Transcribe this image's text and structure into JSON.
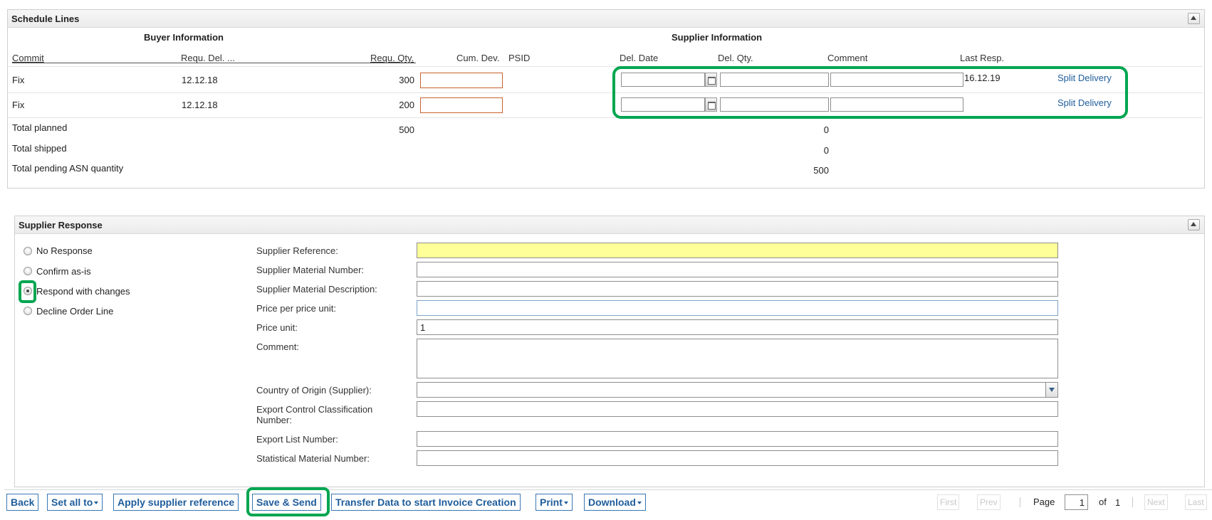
{
  "schedule_lines": {
    "title": "Schedule Lines",
    "buyer_header": "Buyer Information",
    "supplier_header": "Supplier Information",
    "columns": {
      "commit": "Commit",
      "requ_del": "Requ. Del. ...",
      "requ_qty": "Requ. Qty.",
      "cum_dev": "Cum. Dev.",
      "psid": "PSID",
      "del_date": "Del. Date",
      "del_qty": "Del. Qty.",
      "comment": "Comment",
      "last_resp": "Last Resp."
    },
    "rows": [
      {
        "commit": "Fix",
        "requ_del": "12.12.18",
        "requ_qty": "300",
        "last_resp": "16.12.19",
        "split_label": "Split Delivery"
      },
      {
        "commit": "Fix",
        "requ_del": "12.12.18",
        "requ_qty": "200",
        "last_resp": "",
        "split_label": "Split Delivery"
      }
    ],
    "totals": [
      {
        "label": "Total planned",
        "buyer_value": "500",
        "supplier_value": "0"
      },
      {
        "label": "Total shipped",
        "buyer_value": "",
        "supplier_value": "0"
      },
      {
        "label": "Total pending ASN quantity",
        "buyer_value": "",
        "supplier_value": "500"
      }
    ]
  },
  "supplier_response": {
    "title": "Supplier Response",
    "options": [
      {
        "label": "No Response",
        "checked": false
      },
      {
        "label": "Confirm as-is",
        "checked": false
      },
      {
        "label": "Respond with changes",
        "checked": true
      },
      {
        "label": "Decline Order Line",
        "checked": false
      }
    ],
    "fields": {
      "supplier_reference": {
        "label": "Supplier Reference:",
        "value": ""
      },
      "supplier_material_number": {
        "label": "Supplier Material Number:",
        "value": ""
      },
      "supplier_material_description": {
        "label": "Supplier Material Description:",
        "value": ""
      },
      "price_per_unit": {
        "label": "Price per price unit:",
        "value": ""
      },
      "price_unit": {
        "label": "Price unit:",
        "value": "1"
      },
      "comment": {
        "label": "Comment:",
        "value": ""
      },
      "country_of_origin": {
        "label": "Country of Origin (Supplier):",
        "value": ""
      },
      "export_control": {
        "label": "Export Control Classification Number:",
        "value": ""
      },
      "export_list": {
        "label": "Export List Number:",
        "value": ""
      },
      "statistical_material": {
        "label": "Statistical Material Number:",
        "value": ""
      }
    }
  },
  "toolbar": {
    "back": "Back",
    "set_all_to": "Set all to",
    "apply_supplier_reference": "Apply supplier reference",
    "save_send": "Save & Send",
    "transfer_data": "Transfer Data to start Invoice Creation",
    "print": "Print",
    "download": "Download"
  },
  "pagination": {
    "first": "First",
    "prev": "Prev",
    "page_label": "Page",
    "current_page": "1",
    "of_label": "of",
    "total_pages": "1",
    "next": "Next",
    "last": "Last"
  },
  "colors": {
    "highlight_green": "#00a651",
    "link_blue": "#1f5d9c",
    "required_yellow": "#ffff99",
    "error_orange": "#c9602d"
  }
}
